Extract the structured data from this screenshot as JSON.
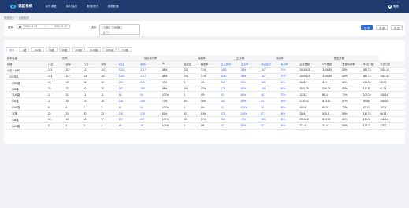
{
  "app": {
    "title": "调度系统",
    "user": "管理"
  },
  "nav": [
    "实时调度",
    "实时监控",
    "数据统计",
    "参数配置"
  ],
  "breadcrumb": {
    "parent": "数据统计",
    "sep": "/",
    "current": "运营报表"
  },
  "filter": {
    "date_label": "日期：",
    "date_start": "2020-11-02",
    "date_sep": "~",
    "date_end": "2020-11-02",
    "line_label": "线路：",
    "tags": [
      "71路",
      "102路",
      "+ 7"
    ],
    "search_label": "查 询",
    "reset_label": "重 置",
    "export_label": "导 出"
  },
  "tabs": [
    "总表",
    "1路",
    "102路",
    "13路",
    "28路",
    "308路",
    "1218路",
    "1406路",
    "714路"
  ],
  "active_tab": 0,
  "table": {
    "group_headers": [
      "基本信息",
      "配车",
      "",
      "班次执行率",
      "",
      "始发率",
      "",
      "正点率",
      "",
      "准点率",
      "",
      "营收里程",
      ""
    ],
    "columns": [
      "线路",
      "计划",
      "实际",
      "计划",
      "实际",
      "计划",
      "实际",
      "%",
      "始发班",
      "始发率",
      "正点班次",
      "正点率",
      "准点班次",
      "准点率",
      "运营里程",
      "GPS里程",
      "里程利用率",
      "车均行程",
      "车日行程"
    ],
    "rows": [
      [
        "公交一公司",
        "113",
        "112",
        "107",
        "107",
        "1251",
        "1717",
        "88%",
        "701",
        "72%",
        "1080",
        "58%",
        "787",
        "70%",
        "15016.25",
        "13458.89",
        "88%",
        "880.78",
        "1061.47"
      ],
      [
        "101车队",
        "113",
        "112",
        "108",
        "107",
        "1251",
        "1717",
        "88%",
        "701",
        "72%",
        "1080",
        "58%",
        "787",
        "70%",
        "15016.25",
        "13458.89",
        "88%",
        "880.78",
        "1061.47"
      ],
      [
        "1310路",
        "10",
        "10",
        "16",
        "10",
        "223",
        "210",
        "90%",
        "8",
        "4%",
        "211",
        "99%",
        "183",
        "86%",
        "1688.1",
        "1341",
        "83%",
        "138.38",
        "68.91"
      ],
      [
        "126路",
        "24",
        "22",
        "20",
        "20",
        "267",
        "188",
        "88%",
        "161",
        "75%",
        "175",
        "82%",
        "148",
        "60%",
        "3531.58",
        "3286.28",
        "88%",
        "112.82",
        "61.24"
      ],
      [
        "7140路",
        "11",
        "11",
        "11",
        "11",
        "84",
        "84",
        "100%",
        "0",
        "0%",
        "63",
        "80%",
        "48",
        "72%",
        "1233.2",
        "886.4",
        "74%",
        "109.29",
        "108.34"
      ],
      [
        "102路",
        "21",
        "19",
        "19",
        "19",
        "218",
        "158",
        "72%",
        "64",
        "39%",
        "157",
        "89%",
        "63",
        "39%",
        "2780.42",
        "2413.52",
        "87%",
        "99.68",
        "108.64"
      ],
      [
        "1040路",
        "6",
        "6",
        "7",
        "7",
        "41",
        "41",
        "100%",
        "0",
        "0%",
        "41",
        "100%",
        "29",
        "90%",
        "460.8",
        "460.8",
        "72%",
        "67.12",
        "102.8"
      ],
      [
        "71路",
        "22",
        "22",
        "20",
        "20",
        "218",
        "178",
        "81%",
        "42",
        "19%",
        "170",
        "100%",
        "87",
        "48%",
        "2846",
        "2458.5",
        "86%",
        "140.78",
        "96.53"
      ],
      [
        "308路",
        "18",
        "18",
        "18",
        "17",
        "207",
        "207",
        "100%",
        "15",
        "10%",
        "160",
        "75%",
        "163",
        "68%",
        "2343.35",
        "2343.35",
        "88%",
        "130.51",
        "148.44"
      ],
      [
        "1406路",
        "4",
        "4",
        "5",
        "4",
        "48",
        "48",
        "100%",
        "0",
        "0%",
        "43",
        "90%",
        "57",
        "64%",
        "714.4",
        "704.4",
        "88%",
        "178.7",
        "178.7"
      ]
    ],
    "row_levels": [
      0,
      1,
      2,
      2,
      2,
      2,
      2,
      2,
      2,
      2
    ]
  },
  "colors": {
    "topbar": "#1f3a6e",
    "accent": "#2f6bd6",
    "page_bg": "#f0f2f5"
  }
}
